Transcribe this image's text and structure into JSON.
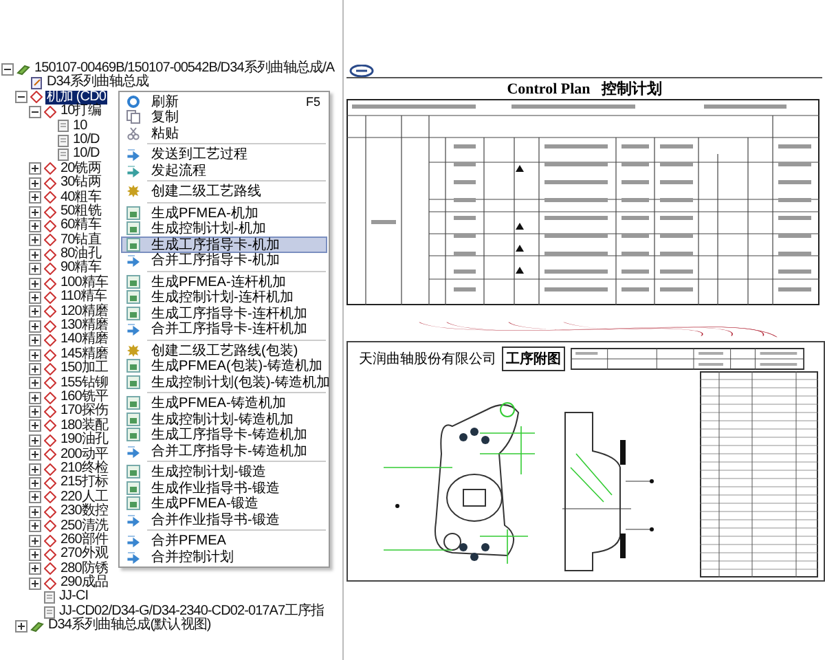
{
  "tree": {
    "nodes": [
      {
        "label": "150107-00469B/150107-00542B/D34系列曲轴总成/A",
        "kind": "assembly",
        "expanded": true,
        "selected": false,
        "children": [
          {
            "label": "D34系列曲轴总成",
            "kind": "document",
            "selected": false
          },
          {
            "label": "机加 (CD0",
            "kind": "operation",
            "expanded": true,
            "selected": true,
            "children": [
              {
                "label": "10打编",
                "kind": "operation",
                "expanded": true,
                "selected": false,
                "children": [
                  {
                    "label": "10",
                    "kind": "sheet",
                    "selected": false
                  },
                  {
                    "label": "10/D",
                    "kind": "sheet",
                    "selected": false
                  },
                  {
                    "label": "10/D",
                    "kind": "sheet",
                    "selected": false
                  }
                ]
              },
              {
                "label": "20铣两",
                "kind": "operation",
                "expanded": false,
                "selected": false
              },
              {
                "label": "30钻两",
                "kind": "operation",
                "expanded": false,
                "selected": false
              },
              {
                "label": "40粗车",
                "kind": "operation",
                "expanded": false,
                "selected": false
              },
              {
                "label": "50粗铣",
                "kind": "operation",
                "expanded": false,
                "selected": false
              },
              {
                "label": "60精车",
                "kind": "operation",
                "expanded": false,
                "selected": false
              },
              {
                "label": "70钻直",
                "kind": "operation",
                "expanded": false,
                "selected": false
              },
              {
                "label": "80油孔",
                "kind": "operation",
                "expanded": false,
                "selected": false
              },
              {
                "label": "90精车",
                "kind": "operation",
                "expanded": false,
                "selected": false
              },
              {
                "label": "100精车",
                "kind": "operation",
                "expanded": false,
                "selected": false
              },
              {
                "label": "110精车",
                "kind": "operation",
                "expanded": false,
                "selected": false
              },
              {
                "label": "120精磨",
                "kind": "operation",
                "expanded": false,
                "selected": false
              },
              {
                "label": "130精磨",
                "kind": "operation",
                "expanded": false,
                "selected": false
              },
              {
                "label": "140精磨",
                "kind": "operation",
                "expanded": false,
                "selected": false
              },
              {
                "label": "145精磨",
                "kind": "operation",
                "expanded": false,
                "selected": false
              },
              {
                "label": "150加工",
                "kind": "operation",
                "expanded": false,
                "selected": false
              },
              {
                "label": "155钻铆",
                "kind": "operation",
                "expanded": false,
                "selected": false
              },
              {
                "label": "160铣平",
                "kind": "operation",
                "expanded": false,
                "selected": false
              },
              {
                "label": "170探伤",
                "kind": "operation",
                "expanded": false,
                "selected": false
              },
              {
                "label": "180装配",
                "kind": "operation",
                "expanded": false,
                "selected": false
              },
              {
                "label": "190油孔",
                "kind": "operation",
                "expanded": false,
                "selected": false
              },
              {
                "label": "200动平",
                "kind": "operation",
                "expanded": false,
                "selected": false
              },
              {
                "label": "210终检",
                "kind": "operation",
                "expanded": false,
                "selected": false
              },
              {
                "label": "215打标",
                "kind": "operation",
                "expanded": false,
                "selected": false
              },
              {
                "label": "220人工",
                "kind": "operation",
                "expanded": false,
                "selected": false
              },
              {
                "label": "230数控",
                "kind": "operation",
                "expanded": false,
                "selected": false
              },
              {
                "label": "250清洗",
                "kind": "operation",
                "expanded": false,
                "selected": false
              },
              {
                "label": "260部件",
                "kind": "operation",
                "expanded": false,
                "selected": false
              },
              {
                "label": "270外观",
                "kind": "operation",
                "expanded": false,
                "selected": false
              },
              {
                "label": "280防锈",
                "kind": "operation",
                "expanded": false,
                "selected": false
              },
              {
                "label": "290成品",
                "kind": "operation",
                "expanded": false,
                "selected": false
              },
              {
                "label": "JJ-CI",
                "kind": "sheet",
                "selected": false
              },
              {
                "label": "JJ-CD02/D34-G/D34-2340-CD02-017A7工序指",
                "kind": "sheet",
                "selected": false
              }
            ]
          },
          {
            "label": "D34系列曲轴总成(默认视图)",
            "kind": "assembly",
            "expanded": false,
            "selected": false
          }
        ]
      }
    ]
  },
  "context_menu": {
    "groups": [
      [
        {
          "label": "刷新",
          "shortcut": "F5",
          "kind": "refresh",
          "selected": false
        },
        {
          "label": "复制",
          "kind": "copy",
          "selected": false
        },
        {
          "label": "粘贴",
          "kind": "paste",
          "selected": false
        }
      ],
      [
        {
          "label": "发送到工艺过程",
          "kind": "send",
          "selected": false
        },
        {
          "label": "发起流程",
          "kind": "flow",
          "selected": false
        }
      ],
      [
        {
          "label": "创建二级工艺路线",
          "kind": "gear",
          "selected": false
        }
      ],
      [
        {
          "label": "生成PFMEA-机加",
          "kind": "doc",
          "selected": false
        },
        {
          "label": "生成控制计划-机加",
          "kind": "doc",
          "selected": false
        },
        {
          "label": "生成工序指导卡-机加",
          "kind": "doc",
          "selected": true
        },
        {
          "label": "合并工序指导卡-机加",
          "kind": "merge",
          "selected": false
        }
      ],
      [
        {
          "label": "生成PFMEA-连杆机加",
          "kind": "doc",
          "selected": false
        },
        {
          "label": "生成控制计划-连杆机加",
          "kind": "doc",
          "selected": false
        },
        {
          "label": "生成工序指导卡-连杆机加",
          "kind": "doc",
          "selected": false
        },
        {
          "label": "合并工序指导卡-连杆机加",
          "kind": "merge",
          "selected": false
        }
      ],
      [
        {
          "label": "创建二级工艺路线(包装)",
          "kind": "gear",
          "selected": false
        },
        {
          "label": "生成PFMEA(包装)-铸造机加",
          "kind": "doc",
          "selected": false
        },
        {
          "label": "生成控制计划(包装)-铸造机加",
          "kind": "doc",
          "selected": false
        }
      ],
      [
        {
          "label": "生成PFMEA-铸造机加",
          "kind": "doc",
          "selected": false
        },
        {
          "label": "生成控制计划-铸造机加",
          "kind": "doc",
          "selected": false
        },
        {
          "label": "生成工序指导卡-铸造机加",
          "kind": "doc",
          "selected": false
        },
        {
          "label": "合并工序指导卡-铸造机加",
          "kind": "merge",
          "selected": false
        }
      ],
      [
        {
          "label": "生成控制计划-锻造",
          "kind": "doc",
          "selected": false
        },
        {
          "label": "生成作业指导书-锻造",
          "kind": "doc",
          "selected": false
        },
        {
          "label": "生成PFMEA-锻造",
          "kind": "doc",
          "selected": false
        },
        {
          "label": "合并作业指导书-锻造",
          "kind": "merge",
          "selected": false
        }
      ],
      [
        {
          "label": "合并PFMEA",
          "kind": "merge",
          "selected": false
        },
        {
          "label": "合并控制计划",
          "kind": "merge",
          "selected": false
        }
      ]
    ]
  },
  "control_plan": {
    "title_en": "Control Plan",
    "title_zh": "控制计划"
  },
  "process_drawing": {
    "company": "天润曲轴股份有限公司",
    "title": "工序附图"
  }
}
